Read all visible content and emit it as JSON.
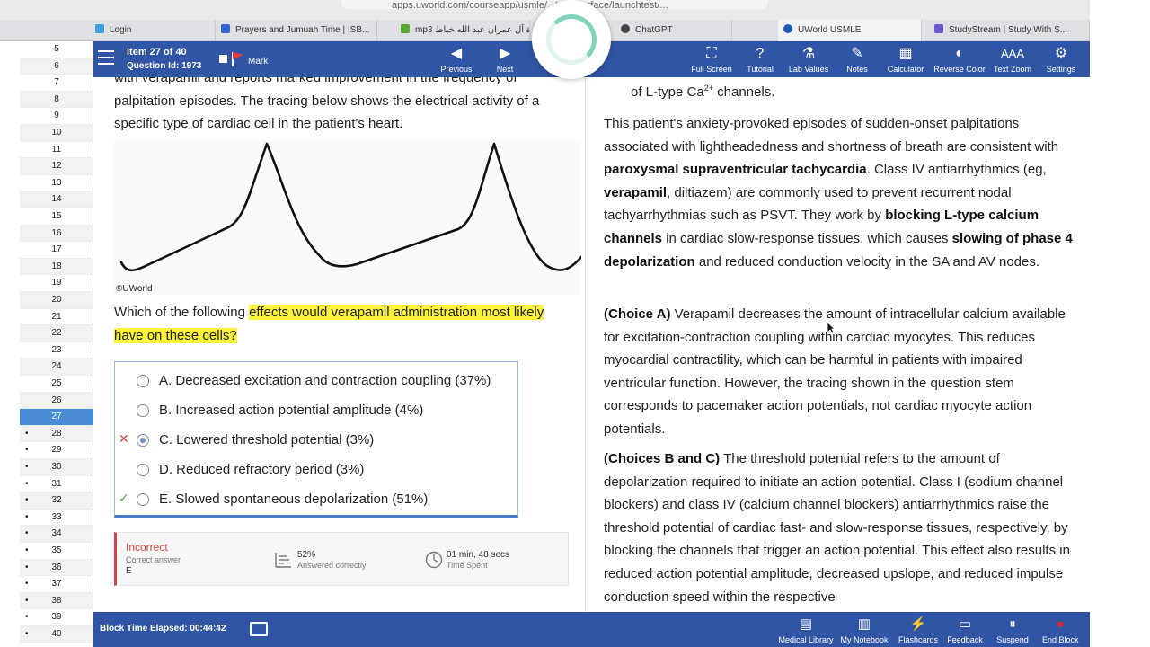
{
  "browser": {
    "url": "apps.uworld.com/courseapp/usmle/...testinterface/launchtest/...",
    "tabs": [
      {
        "label": "Login",
        "color": "#3aa0d8"
      },
      {
        "label": "Prayers and Jumuah Time | ISB...",
        "color": "#3366cc"
      },
      {
        "label": "mp3 سورة آل عمران عبد الله خياط",
        "color": "#55aa33"
      },
      {
        "label": "ChatGPT",
        "color": "#444444"
      },
      {
        "label": "UWorld USMLE",
        "color": "#1e5bb8"
      },
      {
        "label": "StudyStream | Study With S...",
        "color": "#6a5acd"
      }
    ]
  },
  "sidebar": {
    "numbers": [
      "5",
      "6",
      "7",
      "8",
      "9",
      "10",
      "11",
      "12",
      "13",
      "14",
      "15",
      "16",
      "17",
      "18",
      "19",
      "20",
      "21",
      "22",
      "23",
      "24",
      "25",
      "26",
      "27",
      "28",
      "29",
      "30",
      "31",
      "32",
      "33",
      "34",
      "35",
      "36",
      "37",
      "38",
      "39",
      "40"
    ],
    "current": "27"
  },
  "toolbar": {
    "item": "Item 27 of 40",
    "question_id": "Question Id: 1973",
    "mark": "Mark",
    "previous": "Previous",
    "next": "Next",
    "full_screen": "Full Screen",
    "tutorial": "Tutorial",
    "lab_values": "Lab Values",
    "notes": "Notes",
    "calculator": "Calculator",
    "reverse_color": "Reverse Color",
    "text_zoom": "Text Zoom",
    "settings": "Settings"
  },
  "question": {
    "stem": "with verapamil and reports marked improvement in the frequency of palpitation episodes.  The tracing below shows the electrical activity of a specific type of cardiac cell in the patient's heart.",
    "copyright": "©UWorld",
    "prompt_before": "Which of the following ",
    "prompt_highlight": "effects would verapamil administration most likely have on these cells?",
    "choices": [
      {
        "letter": "A.",
        "text": "Decreased excitation and contraction coupling (37%)",
        "mark": ""
      },
      {
        "letter": "B.",
        "text": "Increased action potential amplitude (4%)",
        "mark": ""
      },
      {
        "letter": "C.",
        "text": "Lowered threshold potential (3%)",
        "mark": "✕"
      },
      {
        "letter": "D.",
        "text": "Reduced refractory period (3%)",
        "mark": ""
      },
      {
        "letter": "E.",
        "text": "Slowed spontaneous depolarization (51%)",
        "mark": "✓"
      }
    ],
    "selected": "C"
  },
  "result": {
    "status": "Incorrect",
    "correct_label": "Correct answer",
    "correct_value": "E",
    "percent": "52%",
    "percent_label": "Answered correctly",
    "time": "01 min, 48 secs",
    "time_label": "Time Spent"
  },
  "explanation": {
    "p0": "of L-type Ca",
    "p0_sup": "2+",
    "p0_end": " channels.",
    "p1_a": "This patient's anxiety-provoked episodes of sudden-onset palpitations associated with lightheadedness and shortness of breath are consistent with ",
    "p1_b": "paroxysmal supraventricular tachycardia",
    "p1_c": ".  Class IV antiarrhythmics (eg, ",
    "p1_d": "verapamil",
    "p1_e": ", diltiazem) are commonly used to prevent recurrent nodal tachyarrhythmias such as PSVT.  They work by ",
    "p1_f": "blocking L-type calcium channels",
    "p1_g": " in cardiac slow-response tissues, which causes ",
    "p1_h": "slowing of phase 4 depolarization",
    "p1_i": " and reduced conduction velocity in the SA and AV nodes.",
    "p2_label": "(Choice A)",
    "p2_text": "  Verapamil decreases the amount of intracellular calcium available for excitation-contraction coupling within cardiac myocytes.  This reduces myocardial contractility, which can be harmful in patients with impaired ventricular function.  However, the tracing shown in the question stem corresponds to pacemaker action potentials, not cardiac myocyte action potentials.",
    "p3_label": "(Choices B and C)",
    "p3_text": "  The threshold potential refers to the amount of depolarization required to initiate an action potential.  Class I (sodium channel blockers) and class IV (calcium channel blockers) antiarrhythmics raise the threshold potential of cardiac fast- and slow-response tissues, respectively, by blocking the channels that trigger an action potential.  This effect also results in reduced action potential amplitude, decreased upslope, and reduced impulse conduction speed within the respective"
  },
  "bottom": {
    "elapsed": "Block Time Elapsed: 00:44:42",
    "medical_library": "Medical Library",
    "my_notebook": "My Notebook",
    "flashcards": "Flashcards",
    "feedback": "Feedback",
    "suspend": "Suspend",
    "end_block": "End Block"
  },
  "colors": {
    "toolbar": "#2f55a4",
    "highlight": "#fbf23a",
    "incorrect": "#d6453d",
    "correct": "#4caa55",
    "current_item": "#4a8bd6"
  }
}
